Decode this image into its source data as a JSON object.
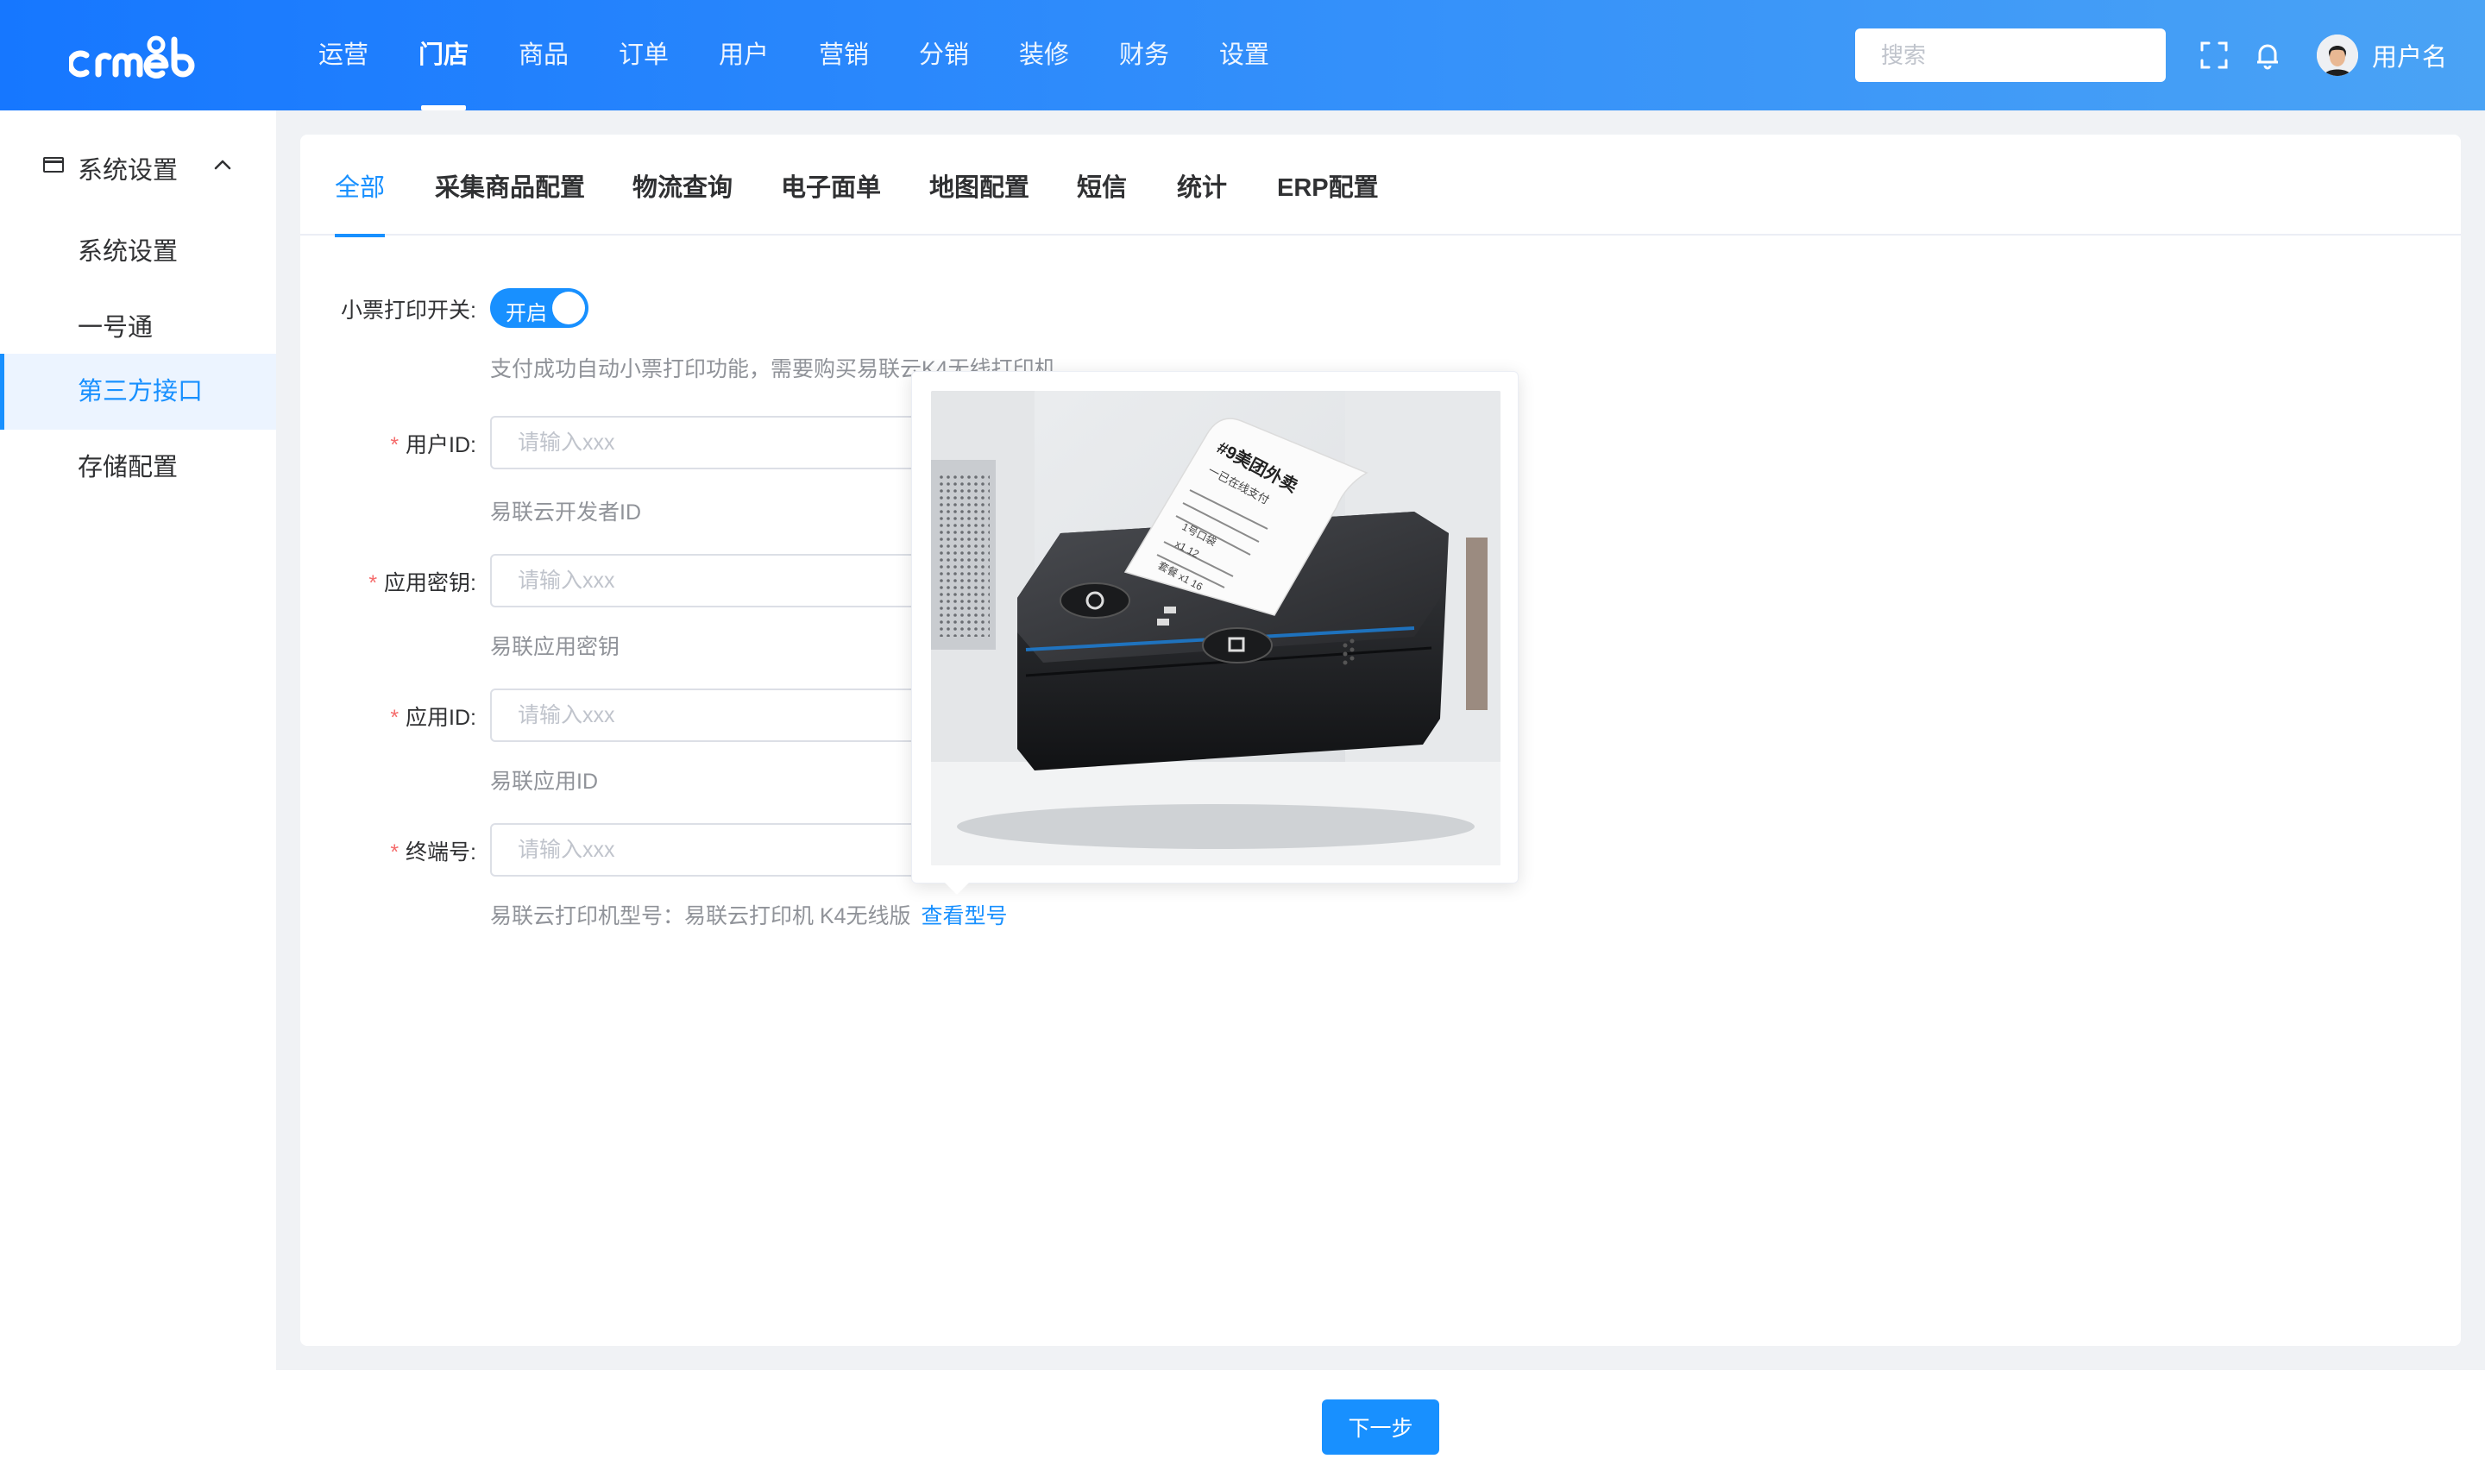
{
  "brand": {
    "logo_text": "crmeb",
    "accent": "#1890ff"
  },
  "header": {
    "nav": [
      "运营",
      "门店",
      "商品",
      "订单",
      "用户",
      "营销",
      "分销",
      "装修",
      "财务",
      "设置"
    ],
    "active_nav": "门店",
    "search_placeholder": "搜索",
    "icons": [
      "fullscreen-icon",
      "bell-icon"
    ],
    "username": "用户名"
  },
  "sidebar": {
    "group_label": "系统设置",
    "items": [
      {
        "label": "系统设置",
        "active": false
      },
      {
        "label": "一号通",
        "active": false
      },
      {
        "label": "第三方接口",
        "active": true
      },
      {
        "label": "存储配置",
        "active": false
      }
    ]
  },
  "tabs": [
    "全部",
    "采集商品配置",
    "物流查询",
    "电子面单",
    "地图配置",
    "短信",
    "统计",
    "ERP配置"
  ],
  "active_tab": "全部",
  "form": {
    "print_switch": {
      "label": "小票打印开关:",
      "state_text": "开启",
      "tip": "支付成功自动小票打印功能，需要购买易联云K4无线打印机"
    },
    "user_id": {
      "label": "用户ID:",
      "placeholder": "请输入xxx",
      "value": "",
      "tip": "易联云开发者ID"
    },
    "app_secret": {
      "label": "应用密钥:",
      "placeholder": "请输入xxx",
      "value": "",
      "tip": "易联应用密钥"
    },
    "app_id": {
      "label": "应用ID:",
      "placeholder": "请输入xxx",
      "value": "",
      "tip": "易联应用ID"
    },
    "terminal_no": {
      "label": "终端号:",
      "placeholder": "请输入xxx",
      "value": "",
      "tip": "易联云打印机型号：易联云打印机 K4无线版",
      "link": "查看型号"
    }
  },
  "popover": {
    "image": "receipt-printer",
    "receipt_text": [
      "#9美团外卖",
      "一已在线支付",
      "1号口袋",
      "x1 12",
      "套餐 x1 16"
    ]
  },
  "footer": {
    "next_label": "下一步"
  }
}
